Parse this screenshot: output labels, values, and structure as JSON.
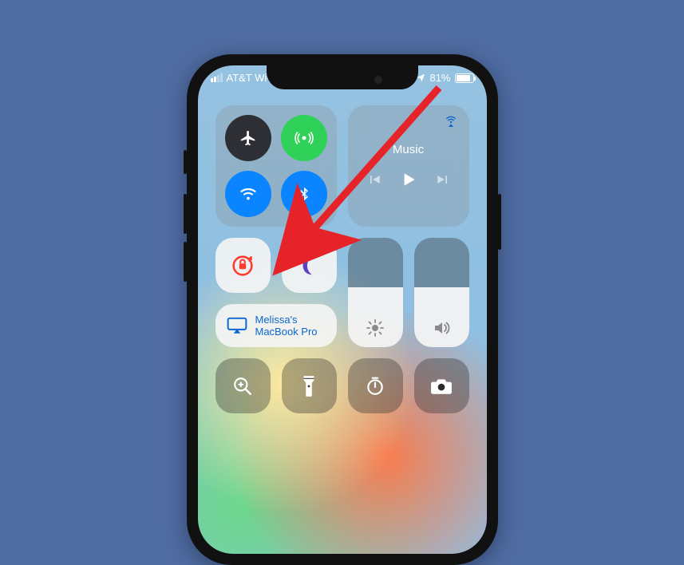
{
  "status": {
    "carrier": "AT&T Wi-Fi",
    "battery_pct": "81%"
  },
  "music": {
    "title": "Music"
  },
  "mirror": {
    "device": "Melissa's MacBook Pro"
  },
  "sliders": {
    "brightness_pct": 55,
    "volume_pct": 55
  },
  "toggles": {
    "airplane": false,
    "cellular": true,
    "wifi": true,
    "bluetooth": true,
    "orientation_lock": true,
    "do_not_disturb": false
  },
  "annotation": {
    "arrow_target": "do-not-disturb-toggle"
  }
}
